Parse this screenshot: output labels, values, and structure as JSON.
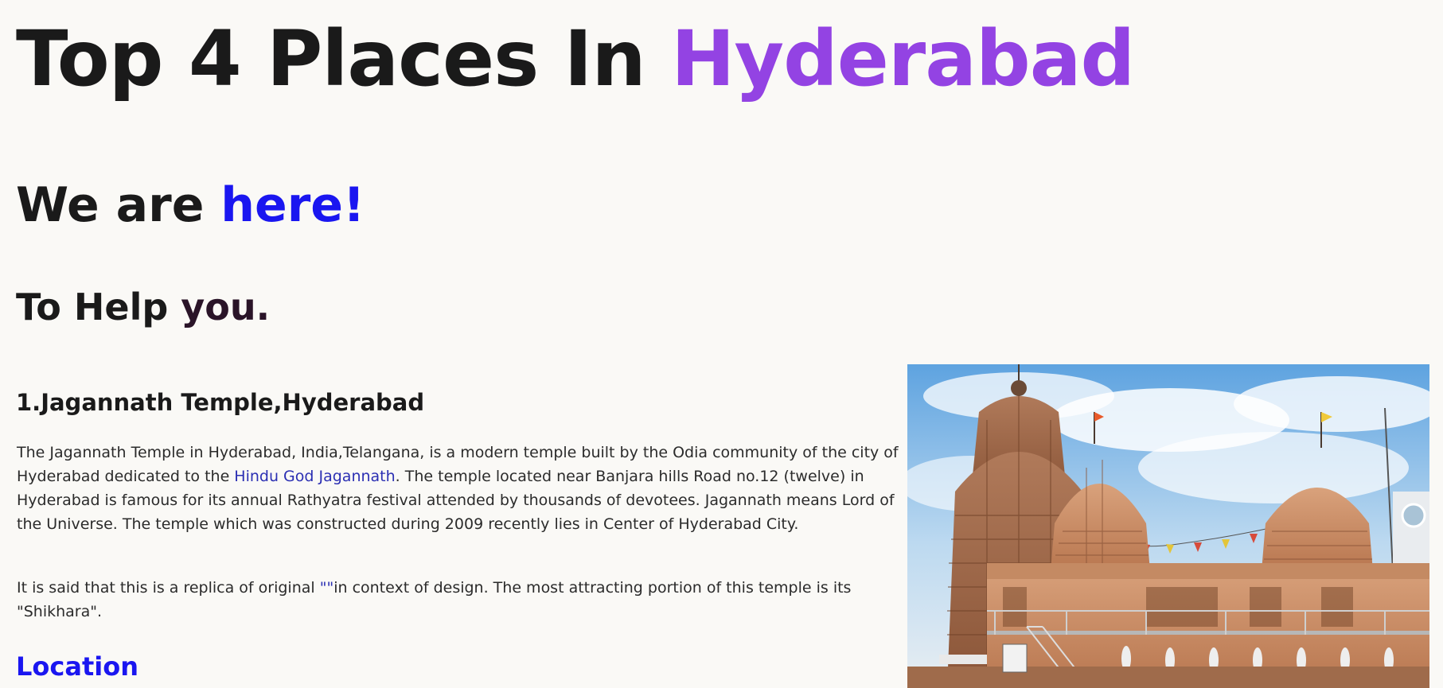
{
  "title": {
    "prefix": "Top 4 Places In ",
    "highlight": "Hyderabad"
  },
  "tagline": {
    "prefix": "We are ",
    "highlight": "here!"
  },
  "subtagline": {
    "prefix": "To Help ",
    "highlight": "you."
  },
  "places": [
    {
      "heading": "1.Jagannath Temple,Hyderabad",
      "para1_before": "The Jagannath Temple in Hyderabad, India,Telangana, is a modern temple built by the Odia community of the city of Hyderabad dedicated to the ",
      "para1_link": "Hindu God Jagannath",
      "para1_after": ". The temple located near Banjara hills Road no.12 (twelve) in Hyderabad is famous for its annual Rathyatra festival attended by thousands of devotees. Jagannath means Lord of the Universe. The temple which was constructed during 2009 recently lies in Center of Hyderabad City.",
      "para2_before": "It is said that this is a replica of original ",
      "para2_link": "\"\"",
      "para2_after": "in context of design. The most attracting portion of this temple is its \"Shikhara\".",
      "location_heading": "Location"
    }
  ],
  "colors": {
    "accent_purple": "#9343e3",
    "accent_blue": "#1a16f0",
    "link": "#2b2fb3",
    "background": "#faf9f6"
  }
}
